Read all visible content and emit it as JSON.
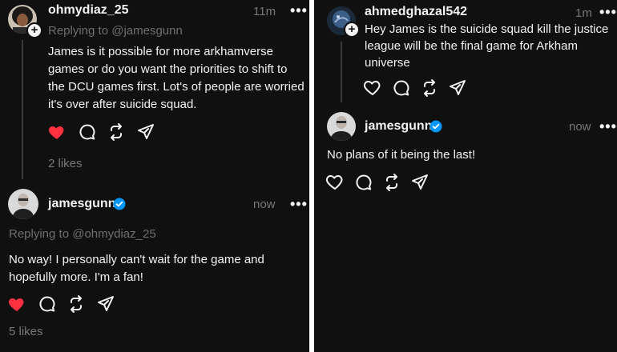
{
  "left": {
    "post1": {
      "username": "ohmydiaz_25",
      "time": "11m",
      "replying_prefix": "Replying to",
      "replying_handle": "@jamesgunn",
      "text": "James is it possible for more arkhamverse games or do you want the priorities to shift to the DCU games first. Lot's of people are worried it's over after suicide squad.",
      "likes": "2 likes",
      "liked": true
    },
    "post2": {
      "username": "jamesgunn",
      "verified": true,
      "time": "now",
      "replying_prefix": "Replying to",
      "replying_handle": "@ohmydiaz_25",
      "text": "No way! I personally can't wait for the game and hopefully more. I'm a fan!",
      "likes": "5 likes",
      "liked": true
    }
  },
  "right": {
    "post1": {
      "username": "ahmedghazal542",
      "time": "1m",
      "text": "Hey James is the suicide squad kill the justice league will be the final game for Arkham universe",
      "liked": false
    },
    "post2": {
      "username": "jamesgunn",
      "verified": true,
      "time": "now",
      "text": "No plans of it being the last!",
      "liked": false
    }
  },
  "menu_glyph": "•••",
  "plus_glyph": "+",
  "colors": {
    "background": "#101010",
    "divider": "#ffffff",
    "text": "#f3f3f3",
    "muted": "#777777",
    "like_red": "#ff3040",
    "verified_blue": "#0095f6"
  },
  "icons": [
    "heart-icon",
    "comment-icon",
    "repost-icon",
    "share-icon",
    "more-icon",
    "verified-badge-icon",
    "plus-icon"
  ]
}
